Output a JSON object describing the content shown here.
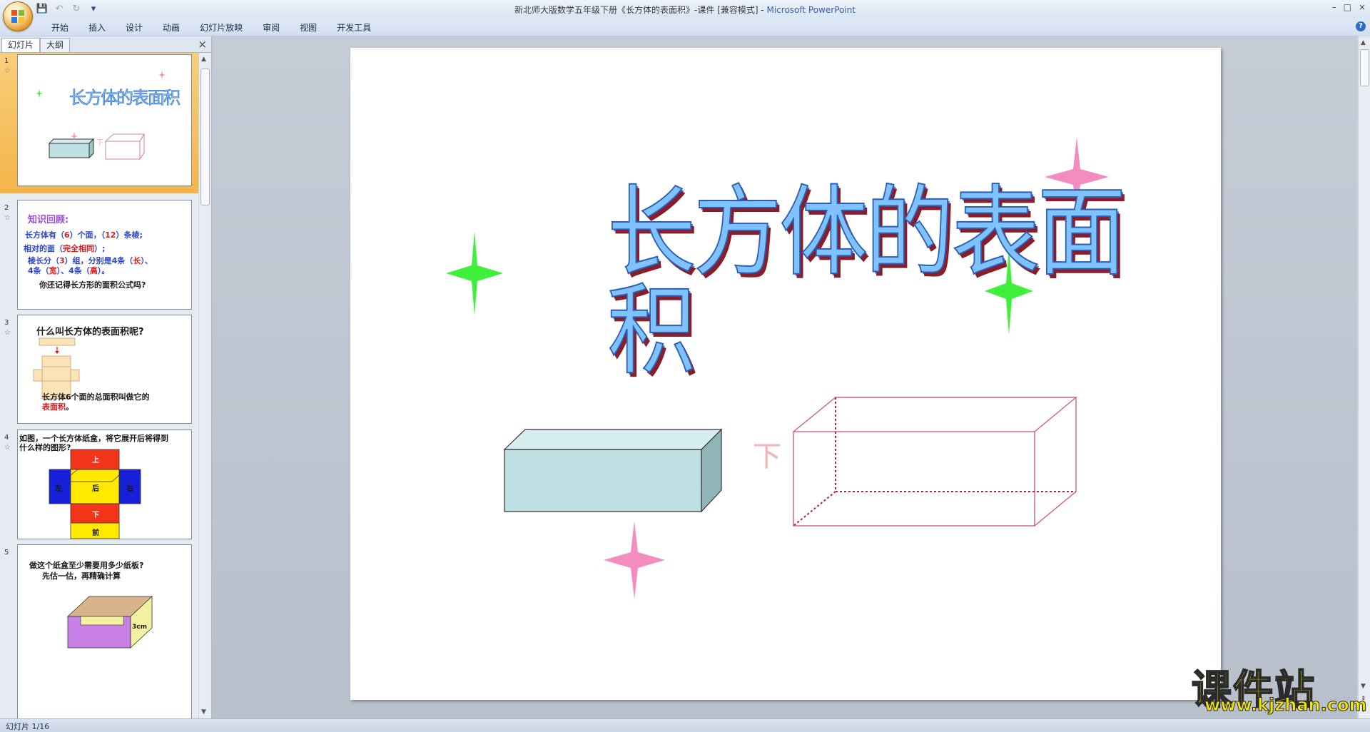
{
  "window": {
    "title": "新北师大版数学五年级下册《长方体的表面积》-课件 [兼容模式] - ",
    "app_name": "Microsoft PowerPoint",
    "controls": [
      "–",
      "□",
      "×"
    ]
  },
  "qat": {
    "save_icon": "save-icon",
    "undo_icon": "undo-icon",
    "redo_icon": "redo-icon",
    "customize_icon": "customize-icon"
  },
  "ribbon": {
    "tabs": [
      "开始",
      "插入",
      "设计",
      "动画",
      "幻灯片放映",
      "审阅",
      "视图",
      "开发工具"
    ],
    "help": "?"
  },
  "panel": {
    "tabs": [
      "幻灯片",
      "大纲"
    ],
    "close": "×"
  },
  "thumbnails": [
    {
      "num": "1",
      "title": "长方体的表面积",
      "label_down": "下"
    },
    {
      "num": "2",
      "heading": "知识回顾:",
      "line1_a": "长方体有（",
      "line1_b": "6",
      "line1_c": "）个面，（",
      "line1_d": "12",
      "line1_e": "）条棱;",
      "line2_a": "相对的面（",
      "line2_b": "完全相同",
      "line2_c": "）;",
      "line3_a": "棱长分（",
      "line3_b": "3",
      "line3_c": "）组，分别是4条（",
      "line3_d": "长",
      "line3_e": "）、",
      "line4_a": "4条（",
      "line4_b": "宽",
      "line4_c": "）、4条（",
      "line4_d": "高",
      "line4_e": "）。",
      "question": "你还记得长方形的面积公式吗?"
    },
    {
      "num": "3",
      "heading": "什么叫长方体的表面积呢?",
      "text_a": "长方体6个面的总面积叫做它的",
      "text_b": "表面积",
      "text_c": "。"
    },
    {
      "num": "4",
      "heading_a": "如图，一个长方体纸盒，将它展开后将得到",
      "heading_b": "什么样的图形?",
      "faces": {
        "top": "上",
        "left": "左",
        "back": "后",
        "right": "右",
        "bottom": "下",
        "front": "前"
      }
    },
    {
      "num": "5",
      "heading_a": "做这个纸盒至少需要用多少纸板?",
      "heading_b": "先估一估，再精确计算",
      "dim": "3cm"
    }
  ],
  "slide": {
    "title": "长方体的表面积",
    "label_down": "下"
  },
  "status": {
    "slide_info": "幻灯片 1/16"
  },
  "watermark": {
    "main": "课件站",
    "url": "www.kjzhan.com"
  },
  "colors": {
    "title_fill": "#7fc2ff",
    "title_shadow": "#8a1d2a",
    "box_fill": "#bfe0e2",
    "wire_box": "#d0607a",
    "sparkle_pink": "#f48cc0",
    "sparkle_green": "#3ef03a",
    "selection": "#f4b44a"
  }
}
